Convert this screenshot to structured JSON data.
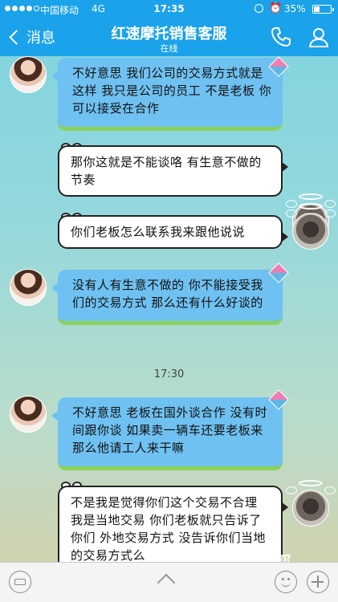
{
  "status_bar": {
    "carrier": "中国移动",
    "network": "4G",
    "time": "17:35",
    "battery_percent": "35%",
    "battery_level": 0.35
  },
  "nav": {
    "back_label": "消息",
    "title": "红速摩托销售客服",
    "subtitle": "在线"
  },
  "messages": [
    {
      "side": "left",
      "text": "不好意思  我们公司的交易方式就是这样 我只是公司的员工  不是老板  你可以接受在合作"
    },
    {
      "side": "right",
      "text": "那你这就是不能谈咯    有生意不做的节奏"
    },
    {
      "side": "right",
      "text": "你们老板怎么联系我来跟他说说"
    },
    {
      "side": "left",
      "text": "没有人有生意不做的  你不能接受我们的交易方式 那么还有什么好谈的"
    },
    {
      "side": "left",
      "text": "不好意思   老板在国外谈合作 没有时间跟你谈   如果卖一辆车还要老板来  那么他请工人来干嘛"
    },
    {
      "side": "right",
      "text": "不是我是觉得你们这个交易不合理  我是当地交易 你们老板就只告诉了你们 外地交易方式 没告诉你们当地的交易方式么"
    }
  ],
  "timestamp": "17:30",
  "watermark": {
    "main": "摩托欧耶",
    "sub": "MOTOOY.COM"
  },
  "colors": {
    "header_blue": "#1aa2ea",
    "left_bubble": "#6fc1f1",
    "left_bubble_trim": "#8cd15a",
    "right_bubble": "#ffffff"
  },
  "icons": {
    "back": "chevron-left-icon",
    "phone": "phone-icon",
    "profile": "profile-icon",
    "voice": "voice-keyboard-icon",
    "expand": "chevron-up-icon",
    "emoji": "emoji-icon",
    "plus": "plus-icon"
  }
}
